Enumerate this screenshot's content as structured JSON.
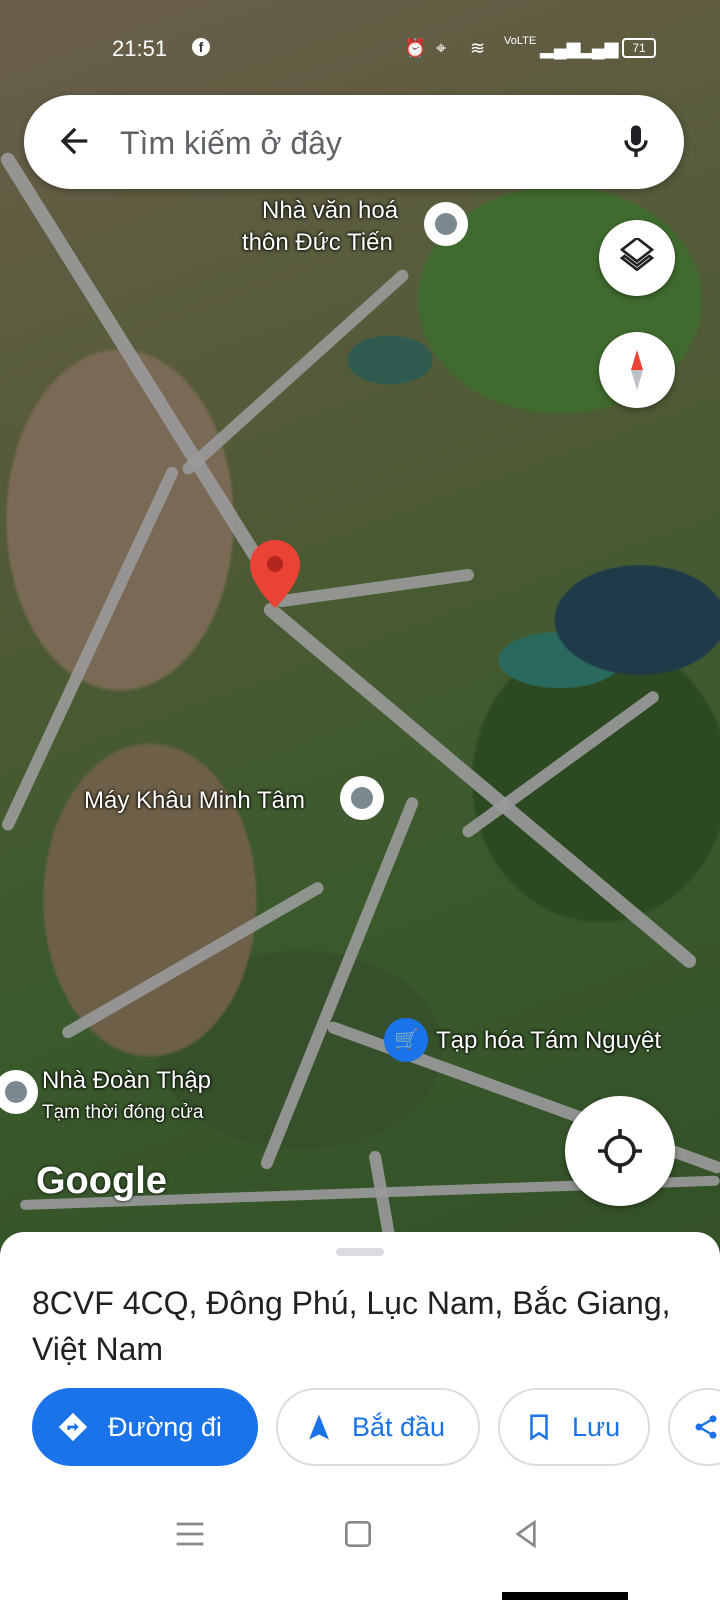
{
  "status_bar": {
    "time": "21:51",
    "network": "VoLTE",
    "battery": "71",
    "icons": [
      "facebook-icon",
      "alarm-icon",
      "location-icon",
      "wifi-icon",
      "signal-icon",
      "battery-icon"
    ]
  },
  "search": {
    "placeholder": "Tìm kiếm ở đây"
  },
  "map": {
    "labels": {
      "culture_house_line1": "Nhà văn hoá",
      "culture_house_line2": "thôn Đức Tiến",
      "sewing": "Máy Khâu Minh Tâm",
      "grocery": "Tạp hóa Tám Nguyệt",
      "doan_thap": "Nhà Đoàn Thập",
      "doan_thap_status": "Tạm thời đóng cửa"
    },
    "attribution": "Google"
  },
  "place": {
    "address": "8CVF 4CQ, Đông Phú, Lục Nam, Bắc Giang, Việt Nam"
  },
  "actions": {
    "directions": "Đường đi",
    "start": "Bắt đầu",
    "save": "Lưu"
  },
  "colors": {
    "accent": "#1a73e8",
    "pin": "#ea4335"
  }
}
